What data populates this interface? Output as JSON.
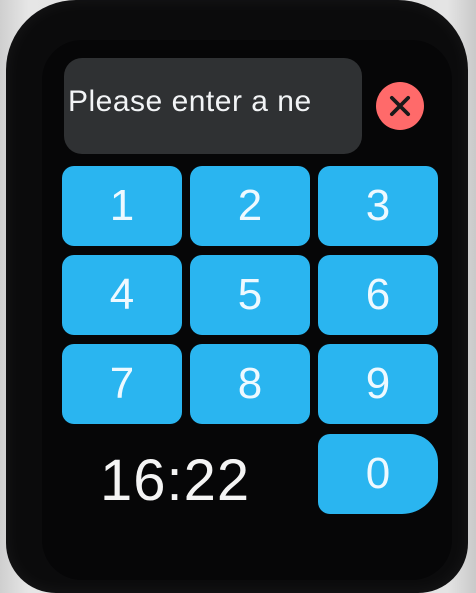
{
  "prompt": {
    "text": "Please enter a ne"
  },
  "close_icon_label": "×",
  "keypad": {
    "keys": [
      "1",
      "2",
      "3",
      "4",
      "5",
      "6",
      "7",
      "8",
      "9",
      "0"
    ]
  },
  "status": {
    "time": "16:22"
  },
  "colors": {
    "key_background": "#2ab5f0",
    "close_button": "#ff6a6a",
    "prompt_background": "#2f3133"
  }
}
